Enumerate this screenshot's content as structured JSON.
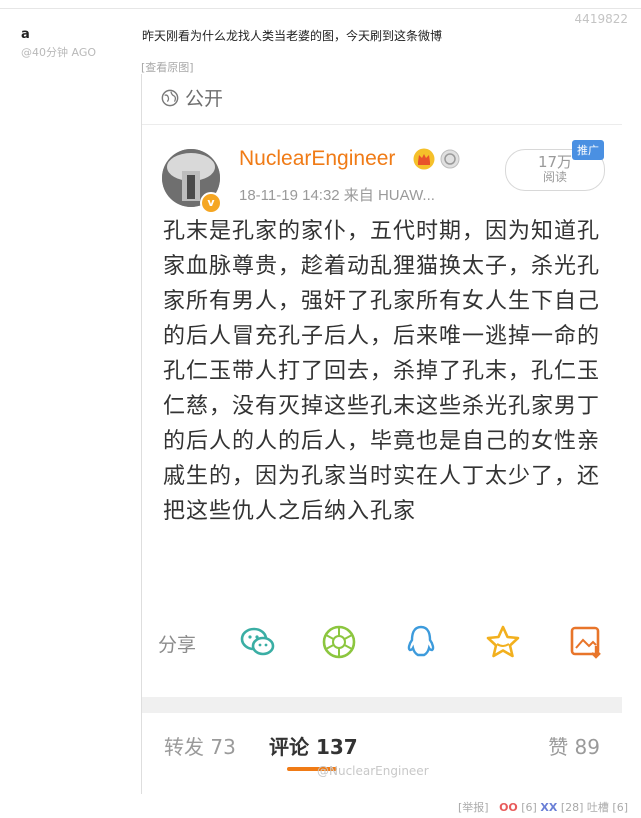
{
  "post": {
    "id": "4419822",
    "author": "a",
    "time": "@40分钟 AGO",
    "caption": "昨天刚看为什么龙找人类当老婆的图，今天刷到这条微博",
    "view_original": "[查看原图]"
  },
  "screenshot": {
    "visibility": "公开",
    "username": "NuclearEngineer",
    "meta": "18-11-19 14:32  来自 HUAW...",
    "reads_count": "17万",
    "reads_unit": "阅读",
    "promo_badge": "推广",
    "body_text": "孔末是孔家的家仆，五代时期，因为知道孔家血脉尊贵，趁着动乱狸猫换太子，杀光孔家所有男人，强奸了孔家所有女人生下自己的后人冒充孔子后人，后来唯一逃掉一命的孔仁玉带人打了回去，杀掉了孔末，孔仁玉仁慈，没有灭掉这些孔末这些杀光孔家男丁的后人的人的后人，毕竟也是自己的女性亲戚生的，因为孔家当时实在人丁太少了，还把这些仇人之后纳入孔家",
    "share_label": "分享",
    "share_icons": [
      "wechat-icon",
      "moments-icon",
      "qq-icon",
      "favorite-star-icon",
      "save-image-icon"
    ],
    "forward": "转发 73",
    "comment": "评论 137",
    "like": "赞 89",
    "watermark": "@NuclearEngineer"
  },
  "footer": {
    "report": "[举报]",
    "oo": "OO",
    "oo_count": "[6]",
    "xx": "XX",
    "xx_count": "[28]",
    "tucao": "吐槽 [6]"
  },
  "colors": {
    "accent": "#f07b16",
    "promo": "#4a90e2",
    "share_teal": "#3aaea4",
    "share_green": "#8cc63f",
    "share_blue": "#3d9bdc",
    "share_gold": "#f2b01e",
    "share_orange": "#e8752a"
  }
}
